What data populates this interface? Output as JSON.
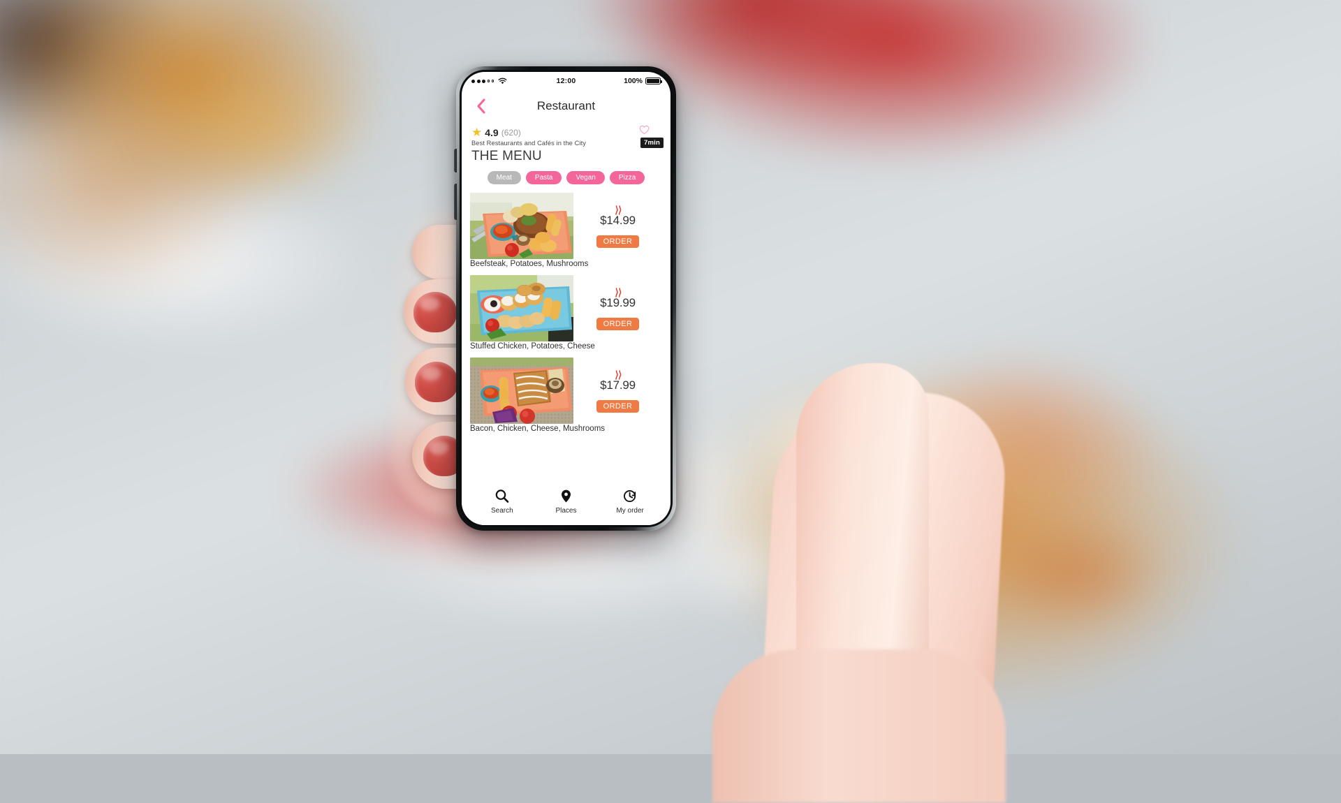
{
  "statusbar": {
    "signal_filled": 3,
    "signal_empty": 2,
    "wifi_icon": "wifi-icon",
    "time": "12:00",
    "battery_percent": "100%",
    "battery_icon": "battery-full-icon"
  },
  "navbar": {
    "back_icon": "chevron-left-icon",
    "title": "Restaurant"
  },
  "hero": {
    "star_icon": "star-icon",
    "rating": "4.9",
    "review_count": "(620)",
    "subtitle": "Best Restaurants and Cafés in the City",
    "menu_heading": "THE MENU",
    "favorite_icon": "heart-outline-icon",
    "delivery_time": "7min"
  },
  "filters": [
    {
      "label": "Meat",
      "active": false
    },
    {
      "label": "Pasta",
      "active": true
    },
    {
      "label": "Vegan",
      "active": true
    },
    {
      "label": "Pizza",
      "active": true
    }
  ],
  "menu_items": [
    {
      "caption": "Beefsteak, Potatoes, Mushrooms",
      "price": "$14.99",
      "order_label": "ORDER",
      "steam_icon": "steam-hot-icon",
      "image_name": "beefsteak-plate-photo"
    },
    {
      "caption": "Stuffed Chicken, Potatoes, Cheese",
      "price": "$19.99",
      "order_label": "ORDER",
      "steam_icon": "steam-hot-icon",
      "image_name": "stuffed-chicken-plate-photo"
    },
    {
      "caption": "Bacon, Chicken, Cheese, Mushrooms",
      "price": "$17.99",
      "order_label": "ORDER",
      "steam_icon": "steam-hot-icon",
      "image_name": "bacon-chicken-plate-photo"
    }
  ],
  "tabbar": [
    {
      "label": "Search",
      "icon": "search-icon"
    },
    {
      "label": "Places",
      "icon": "map-pin-icon"
    },
    {
      "label": "My order",
      "icon": "clock-history-icon"
    }
  ],
  "colors": {
    "accent_pink": "#f4669a",
    "chip_inactive": "#b8b8b8",
    "order_orange": "#f07a43",
    "star_yellow": "#f2c029",
    "steam_red": "#e03c2e",
    "badge_dark": "#1b1b1b"
  }
}
